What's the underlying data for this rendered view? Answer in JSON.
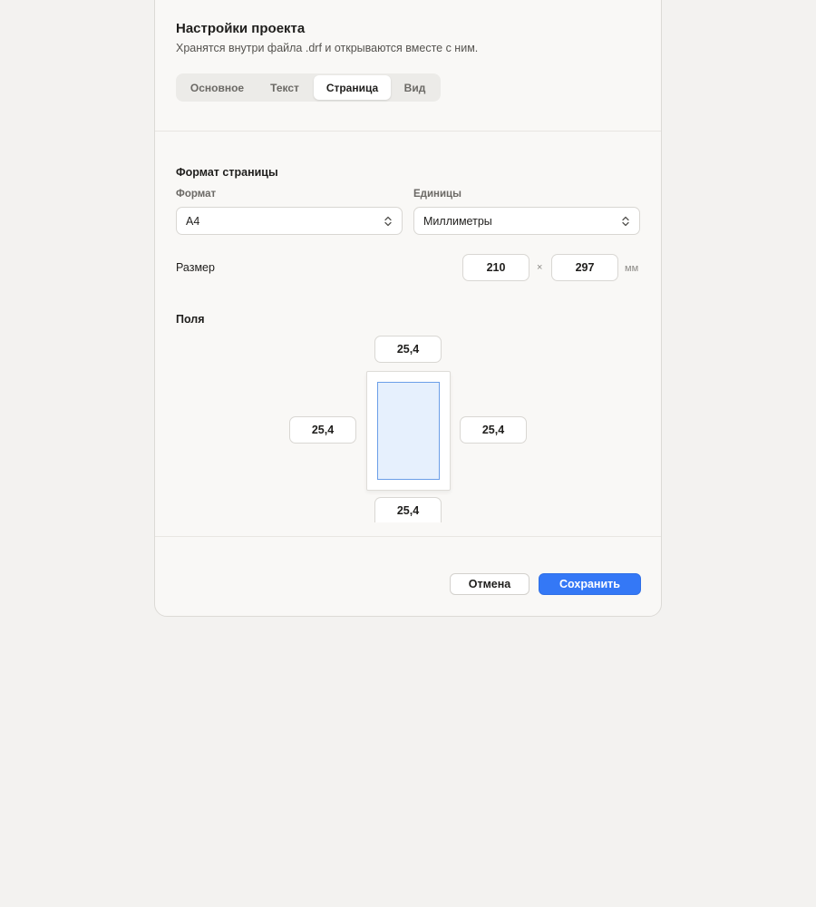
{
  "dialog": {
    "title": "Настройки проекта",
    "subtitle": "Хранятся внутри файла .drf и открываются вместе с ним."
  },
  "tabs": [
    {
      "label": "Основное",
      "active": false
    },
    {
      "label": "Текст",
      "active": false
    },
    {
      "label": "Страница",
      "active": true
    },
    {
      "label": "Вид",
      "active": false
    }
  ],
  "page_format": {
    "section_title": "Формат страницы",
    "format_label": "Формат",
    "format_value": "A4",
    "units_label": "Единицы",
    "units_value": "Миллиметры",
    "size_label": "Размер",
    "width": "210",
    "times": "×",
    "height": "297",
    "unit": "мм"
  },
  "margins": {
    "section_title": "Поля",
    "top": "25,4",
    "left": "25,4",
    "right": "25,4",
    "bottom": "25,4"
  },
  "footer": {
    "cancel_label": "Отмена",
    "save_label": "Сохранить"
  },
  "colors": {
    "accent": "#3478f6",
    "preview_fill": "#e6f0fd",
    "preview_border": "#6b9ee8"
  },
  "icons": {
    "select_chevron": "chevron-up-down-icon"
  }
}
